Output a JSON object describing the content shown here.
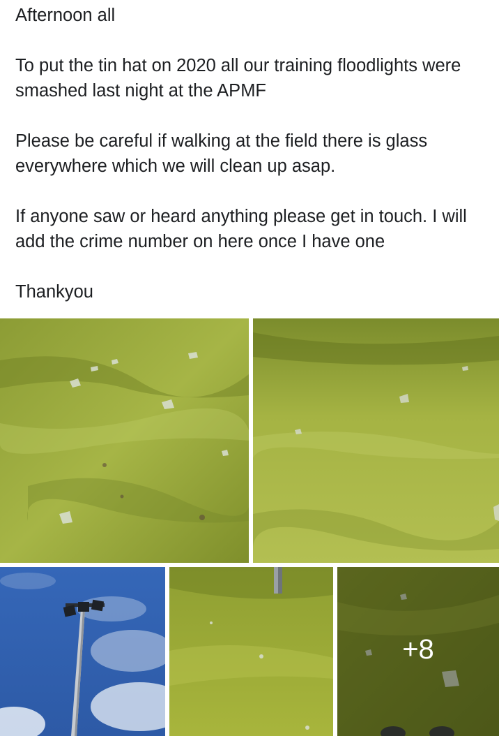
{
  "post": {
    "paragraphs": [
      "Afternoon all",
      "To put the tin hat on 2020 all our training floodlights were smashed last night at the APMF",
      "Please be careful if walking at the field there is glass everywhere which we will clean up asap.",
      "If anyone saw or heard anything please get in touch. I will add the crime number on here once I have one",
      "Thankyou"
    ]
  },
  "photos": {
    "more_count": "+8",
    "items": [
      {
        "subject": "grass with broken glass"
      },
      {
        "subject": "grass with broken glass"
      },
      {
        "subject": "floodlight pole against blue sky"
      },
      {
        "subject": "grass near pole base"
      },
      {
        "subject": "grass with glass and shoes"
      }
    ]
  },
  "colors": {
    "grass_light": "#a3b543",
    "grass_dark": "#6f7e24",
    "sky": "#2d5fae",
    "overlay_text": "#ffffff"
  }
}
